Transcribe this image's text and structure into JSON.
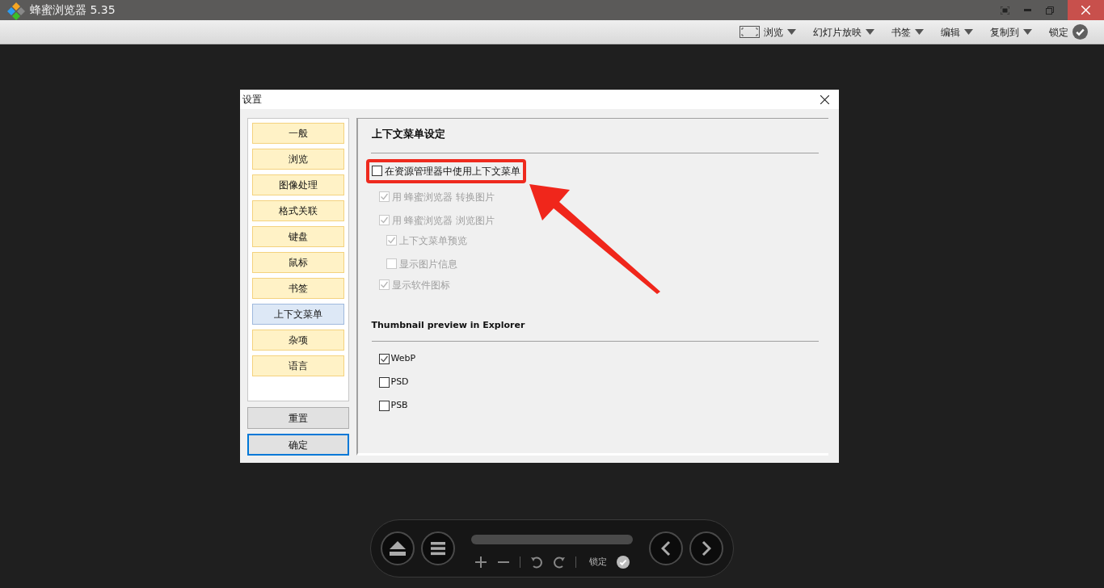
{
  "window": {
    "title": "蜂蜜浏览器 5.35"
  },
  "toolbar": [
    {
      "kind": "view",
      "label": "浏览"
    },
    {
      "kind": "menu",
      "label": "幻灯片放映"
    },
    {
      "kind": "menu",
      "label": "书签"
    },
    {
      "kind": "menu",
      "label": "编辑"
    },
    {
      "kind": "menu",
      "label": "复制到"
    },
    {
      "kind": "lock",
      "label": "锁定"
    }
  ],
  "dialog": {
    "title": "设置",
    "categories": [
      {
        "label": "一般",
        "selected": false
      },
      {
        "label": "浏览",
        "selected": false
      },
      {
        "label": "图像处理",
        "selected": false
      },
      {
        "label": "格式关联",
        "selected": false
      },
      {
        "label": "键盘",
        "selected": false
      },
      {
        "label": "鼠标",
        "selected": false
      },
      {
        "label": "书签",
        "selected": false
      },
      {
        "label": "上下文菜单",
        "selected": true
      },
      {
        "label": "杂项",
        "selected": false
      },
      {
        "label": "语言",
        "selected": false
      }
    ],
    "buttons": [
      {
        "label": "重置",
        "default": false
      },
      {
        "label": "确定",
        "default": true
      }
    ],
    "section_title": "上下文菜单设定",
    "options": [
      {
        "label": "在资源管理器中使用上下文菜单",
        "checked": false,
        "disabled": false,
        "highlighted": true,
        "children": [
          {
            "label": "用 蜂蜜浏览器 转换图片",
            "checked": true,
            "disabled": true,
            "highlighted": false
          },
          {
            "label": "用 蜂蜜浏览器 浏览图片",
            "checked": true,
            "disabled": true,
            "highlighted": false,
            "children": [
              {
                "label": "上下文菜单预览",
                "checked": true,
                "disabled": true,
                "highlighted": false
              },
              {
                "label": "显示图片信息",
                "checked": false,
                "disabled": true,
                "highlighted": false
              }
            ]
          },
          {
            "label": "显示软件图标",
            "checked": true,
            "disabled": true,
            "highlighted": false
          }
        ]
      }
    ],
    "thumbnail_title": "Thumbnail preview in Explorer",
    "thumbnail_options": [
      {
        "label": "WebP",
        "checked": true
      },
      {
        "label": "PSD",
        "checked": false
      },
      {
        "label": "PSB",
        "checked": false
      }
    ]
  },
  "bottom_bar": {
    "lock_label": "锁定"
  }
}
